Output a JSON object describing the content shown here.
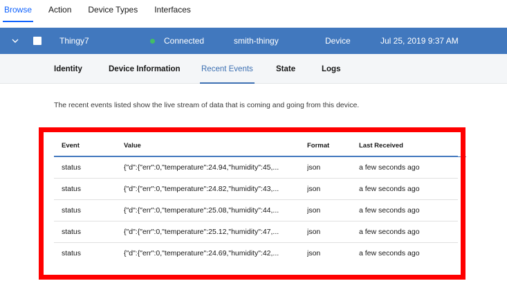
{
  "top_tabs": [
    "Browse",
    "Action",
    "Device Types",
    "Interfaces"
  ],
  "device": {
    "name": "Thingy7",
    "status": "Connected",
    "type_id": "smith-thingy",
    "class": "Device",
    "date": "Jul 25, 2019 9:37 AM"
  },
  "sub_tabs": [
    "Identity",
    "Device Information",
    "Recent Events",
    "State",
    "Logs"
  ],
  "description": "The recent events listed show the live stream of data that is coming and going from this device.",
  "table": {
    "headers": {
      "event": "Event",
      "value": "Value",
      "format": "Format",
      "received": "Last Received"
    },
    "rows": [
      {
        "event": "status",
        "value": "{\"d\":{\"err\":0,\"temperature\":24.94,\"humidity\":45,...",
        "format": "json",
        "received": "a few seconds ago"
      },
      {
        "event": "status",
        "value": "{\"d\":{\"err\":0,\"temperature\":24.82,\"humidity\":43,...",
        "format": "json",
        "received": "a few seconds ago"
      },
      {
        "event": "status",
        "value": "{\"d\":{\"err\":0,\"temperature\":25.08,\"humidity\":44,...",
        "format": "json",
        "received": "a few seconds ago"
      },
      {
        "event": "status",
        "value": "{\"d\":{\"err\":0,\"temperature\":25.12,\"humidity\":47,...",
        "format": "json",
        "received": "a few seconds ago"
      },
      {
        "event": "status",
        "value": "{\"d\":{\"err\":0,\"temperature\":24.69,\"humidity\":42,...",
        "format": "json",
        "received": "a few seconds ago"
      }
    ]
  },
  "colors": {
    "accent": "#0f62fe",
    "row_bg": "#4178be",
    "status_dot": "#42be65",
    "highlight": "#ff0000"
  },
  "icons": {
    "expand": "chevron-down-icon",
    "select": "checkbox-icon",
    "status": "status-dot-icon"
  }
}
